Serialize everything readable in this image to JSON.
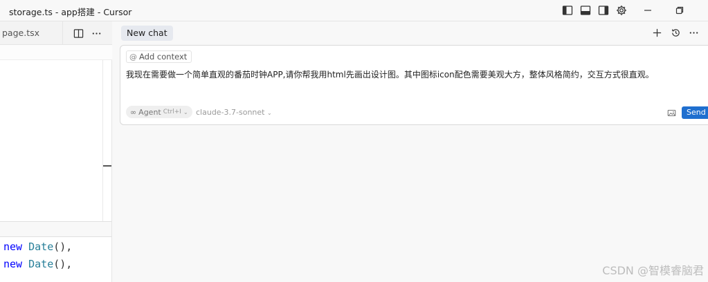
{
  "window": {
    "title": "storage.ts - app搭建 - Cursor"
  },
  "editor": {
    "tab_label": "page.tsx",
    "code_lines": [
      {
        "keyword": "new",
        "class_name": "Date",
        "punct": "(),"
      },
      {
        "keyword": "new",
        "class_name": "Date",
        "punct": "(),"
      }
    ]
  },
  "chat": {
    "tab_label": "New chat",
    "add_context_label": "Add context",
    "prompt_text": "我现在需要做一个简单直观的番茄时钟APP,请你帮我用html先画出设计图。其中图标icon配色需要美观大方，整体风格简约，交互方式很直观。",
    "agent_label": "Agent",
    "agent_shortcut": "Ctrl+I",
    "model_label": "claude-3.7-sonnet",
    "send_label": "Send"
  },
  "watermark": "CSDN @智模睿脑君",
  "colors": {
    "accent": "#1f6fcf",
    "keyword": "#0000ff",
    "class": "#267f99"
  }
}
